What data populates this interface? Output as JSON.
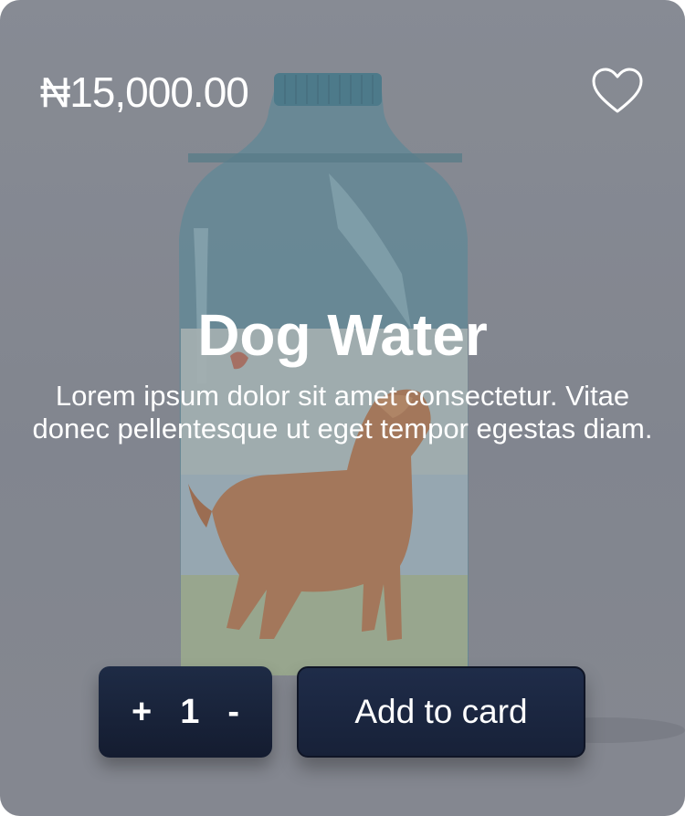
{
  "product": {
    "price": "₦15,000.00",
    "name": "Dog Water",
    "description": "Lorem ipsum dolor sit amet consectetur. Vitae donec pellentesque ut eget tempor egestas diam."
  },
  "quantity": {
    "increment_label": "+",
    "value": "1",
    "decrement_label": "-"
  },
  "actions": {
    "add_to_cart_label": "Add to card"
  },
  "colors": {
    "card_background": "#8a8e96",
    "button_navy": "#1b2640",
    "text": "#ffffff"
  },
  "icons": {
    "favorite": "heart-outline-icon"
  }
}
